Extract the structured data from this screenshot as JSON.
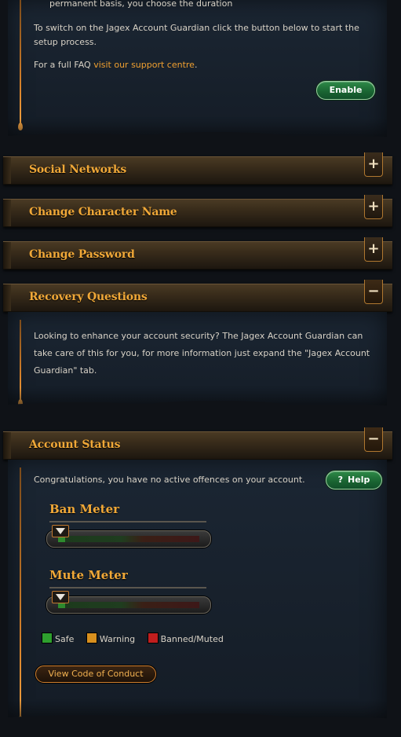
{
  "guardian": {
    "line_top": "permanent basis, you choose the duration",
    "para1": "To switch on the Jagex Account Guardian click the button below to start the setup process.",
    "faq_prefix": "For a full FAQ ",
    "faq_link": "visit our support centre",
    "faq_suffix": ".",
    "enable_label": "Enable"
  },
  "sections": [
    {
      "title": "Social Networks",
      "toggle": "+"
    },
    {
      "title": "Change Character Name",
      "toggle": "+"
    },
    {
      "title": "Change Password",
      "toggle": "+"
    },
    {
      "title": "Recovery Questions",
      "toggle": "−"
    },
    {
      "title": "Account Status",
      "toggle": "−"
    }
  ],
  "recovery": {
    "text": "Looking to enhance your account security? The Jagex Account Guardian can take care of this for you, for more information just expand the \"Jagex Account Guardian\" tab."
  },
  "status": {
    "message": "Congratulations, you have no active offences on your account.",
    "help_label": "Help",
    "help_icon": "?",
    "ban_title": "Ban Meter",
    "ban_level": 0.05,
    "mute_title": "Mute Meter",
    "mute_level": 0.05,
    "legend": [
      {
        "label": "Safe",
        "color": "#2ea02e"
      },
      {
        "label": "Warning",
        "color": "#d8901e"
      },
      {
        "label": "Banned/Muted",
        "color": "#c01e1e"
      }
    ],
    "coc_label": "View Code of Conduct"
  },
  "colors": {
    "accent": "#f0a838",
    "link": "#f0a030",
    "green_button": "#196331"
  }
}
